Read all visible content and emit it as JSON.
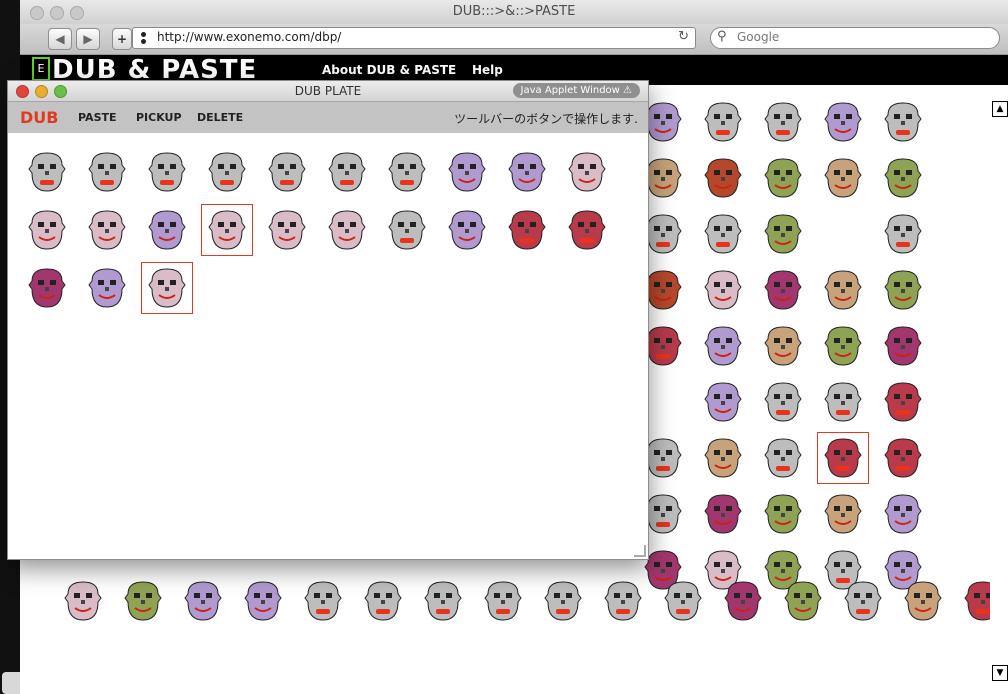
{
  "browser": {
    "window_title": "DUB:::>&::>PASTE",
    "back_label": "◀",
    "forward_label": "▶",
    "add_label": "+",
    "url": "http://www.exonemo.com/dbp/",
    "search_placeholder": "Google"
  },
  "site": {
    "logo": "DUB & PASTE",
    "nav": [
      "About DUB & PASTE",
      "Help"
    ]
  },
  "applet": {
    "title": "DUB PLATE",
    "warning": "Java Applet Window",
    "brand": "DUB",
    "toolbar": [
      "PASTE",
      "PICKUP",
      "DELETE"
    ],
    "hint": "ツールバーのボタンで操作します."
  },
  "colors": {
    "accent_red": "#e03a20",
    "green": "#5ad42b",
    "face_gray": "#bdbdbd",
    "face_pink": "#d9bcc8",
    "face_crimson": "#b83a4b",
    "face_magenta": "#a2376f",
    "face_olive": "#8fa354",
    "face_lavender": "#b09ad0",
    "face_tan": "#c7a27a",
    "face_rust": "#b5482c"
  },
  "icons": {
    "face_item": "face-icon"
  }
}
